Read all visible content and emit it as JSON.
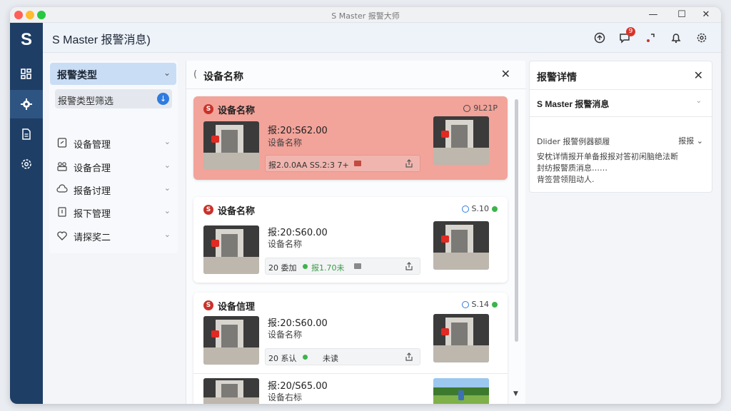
{
  "window": {
    "title": "S Master 报警大师",
    "controls": {
      "minimize": "—",
      "maximize": "☐",
      "close": "✕"
    }
  },
  "sidebar": {
    "logo": "S",
    "items": [
      {
        "name": "dashboard",
        "icon": "grid-icon"
      },
      {
        "name": "settings",
        "icon": "gear-icon",
        "active": true
      },
      {
        "name": "documents",
        "icon": "document-icon"
      },
      {
        "name": "system",
        "icon": "cog-icon"
      }
    ]
  },
  "header": {
    "title": "S Master 报警消息)",
    "notification_count": "9",
    "icons": [
      "refresh-icon",
      "message-icon",
      "signal-icon",
      "bell-icon",
      "gear-icon"
    ]
  },
  "filter": {
    "title": "报警类型",
    "subfilter_label": "报警类型筛选",
    "categories": [
      {
        "label": "设备管理",
        "icon": "device-icon"
      },
      {
        "label": "设备合理",
        "icon": "group-icon"
      },
      {
        "label": "报备讨理",
        "icon": "cloud-icon"
      },
      {
        "label": "报下管理",
        "icon": "report-icon"
      },
      {
        "label": "请探奖二",
        "icon": "heart-icon"
      }
    ]
  },
  "list": {
    "title": "设备名称",
    "back_label": "(",
    "cards": [
      {
        "name": "设备名称",
        "status": "9L21P",
        "status_style": "ring",
        "time": "报:20:S62.00",
        "device": "设备名称",
        "bar_text": "报2.0.0AA SS.2:3 7+",
        "bar_state": "",
        "highlight": true
      },
      {
        "name": "设备名称",
        "status": "S.10",
        "status_style": "ring-dot",
        "time": "报:20:S60.00",
        "device": "设备名称",
        "bar_text": "20 委加",
        "bar_state": "报1.70未",
        "highlight": false
      },
      {
        "name": "设备信理",
        "status": "S.14",
        "status_style": "ring-dot",
        "time": "报:20:S60.00",
        "device": "设备名称",
        "bar_text": "20 系认",
        "bar_state": "未读",
        "highlight": false
      },
      {
        "name": "",
        "status": "",
        "status_style": "",
        "time": "报:20/S65.00",
        "device": "设备右标",
        "bar_text": "",
        "bar_state": "",
        "highlight": false
      }
    ]
  },
  "detail": {
    "title": "报警详情",
    "message_label": "S Master 报警消息",
    "filter_label": "Dlider 报警例器额履",
    "sort_label": "报报",
    "lines": [
      "安枕详情报开单备报报对答初闲脑绝法断",
      "封纺报警质消息……",
      "背签营领阻动人."
    ]
  },
  "colors": {
    "sidebar": "#1e3e66",
    "accent": "#2f7be0",
    "highlight_card": "#f2a39a",
    "alert_red": "#c9332a",
    "ok_green": "#3bb54a"
  }
}
